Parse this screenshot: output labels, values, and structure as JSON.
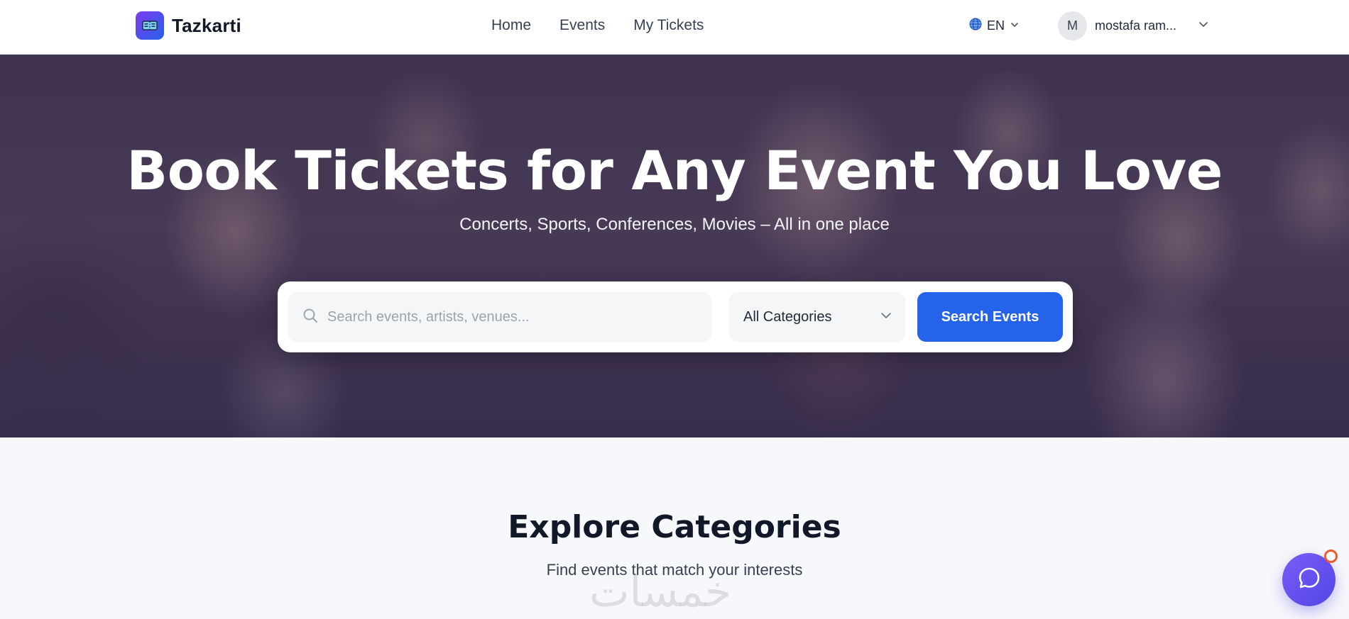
{
  "brand": {
    "name": "Tazkarti",
    "accent": "#2563eb",
    "logo_gradient": [
      "#7c3aed",
      "#2563eb"
    ]
  },
  "nav": {
    "links": [
      {
        "label": "Home"
      },
      {
        "label": "Events"
      },
      {
        "label": "My Tickets"
      }
    ],
    "language": {
      "label": "EN",
      "icon": "globe-icon"
    },
    "user": {
      "initial": "M",
      "name": "mostafa ram..."
    }
  },
  "hero": {
    "title": "Book Tickets for Any Event You Love",
    "subtitle": "Concerts, Sports, Conferences, Movies – All in one place",
    "search": {
      "placeholder": "Search events, artists, venues...",
      "value": "",
      "category_selected": "All Categories",
      "button_label": "Search Events"
    }
  },
  "categories_section": {
    "title": "Explore Categories",
    "subtitle": "Find events that match your interests"
  },
  "watermark": {
    "text": "خمسات"
  },
  "chat": {
    "icon": "chat-bubble-icon",
    "notification_color": "#ef5a2a"
  }
}
